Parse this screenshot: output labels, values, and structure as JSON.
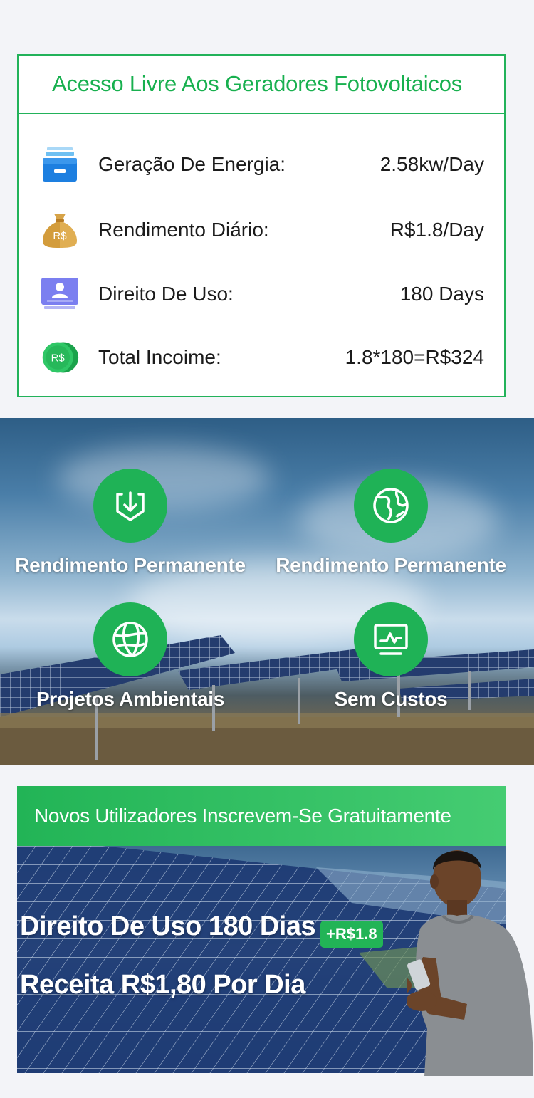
{
  "generators_card": {
    "title": "Acesso Livre Aos Geradores Fotovoltaicos",
    "rows": [
      {
        "icon": "energy-tray-icon",
        "label": "Geração De Energia:",
        "value": "2.58kw/Day"
      },
      {
        "icon": "money-bag-icon",
        "label": "Rendimento Diário:",
        "value": "R$1.8/Day"
      },
      {
        "icon": "user-id-card-icon",
        "label": "Direito De Uso:",
        "value": "180 Days"
      },
      {
        "icon": "coin-icon",
        "label": "Total Incoime:",
        "value": "1.8*180=R$324"
      }
    ],
    "money_bag_text": "R$",
    "coin_text": "R$"
  },
  "features": {
    "items": [
      {
        "icon": "shield-download-icon",
        "label": "Rendimento Permanente"
      },
      {
        "icon": "globe-icon",
        "label": "Rendimento Permanente"
      },
      {
        "icon": "network-globe-icon",
        "label": "Projetos Ambientais"
      },
      {
        "icon": "monitor-chart-icon",
        "label": "Sem Custos"
      }
    ]
  },
  "promo": {
    "title": "Novos Utilizadores Inscrevem-Se Gratuitamente",
    "line1": "Direito De Uso 180 Dias",
    "line2": "Receita R$1,80 Por Dia",
    "badge": "+R$1.8"
  },
  "colors": {
    "accent": "#22b25a",
    "title_green": "#18b04f",
    "background": "#f3f4f8"
  }
}
